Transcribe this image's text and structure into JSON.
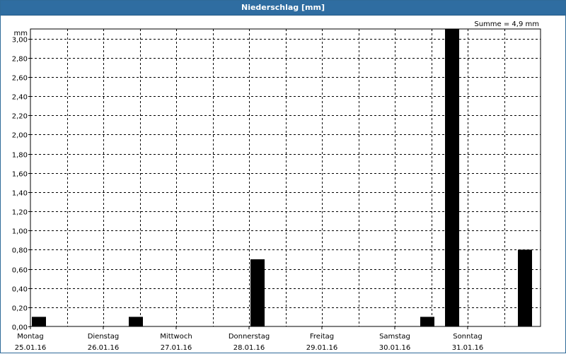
{
  "window": {
    "title": "Niederschlag [mm]"
  },
  "summary": {
    "text": "Summe = 4,9 mm"
  },
  "chart_data": {
    "type": "bar",
    "title": "Niederschlag [mm]",
    "ylabel": "mm",
    "xlabel": "",
    "ylim": [
      0,
      3.1
    ],
    "yticks": [
      "0,00",
      "0,20",
      "0,40",
      "0,60",
      "0,80",
      "1,00",
      "1,20",
      "1,40",
      "1,60",
      "1,80",
      "2,00",
      "2,20",
      "2,40",
      "2,60",
      "2,80",
      "3,00"
    ],
    "x_range_days": [
      0,
      7
    ],
    "days": [
      {
        "weekday": "Montag",
        "date": "25.01.16"
      },
      {
        "weekday": "Dienstag",
        "date": "26.01.16"
      },
      {
        "weekday": "Mittwoch",
        "date": "27.01.16"
      },
      {
        "weekday": "Donnerstag",
        "date": "28.01.16"
      },
      {
        "weekday": "Freitag",
        "date": "29.01.16"
      },
      {
        "weekday": "Samstag",
        "date": "30.01.16"
      },
      {
        "weekday": "Sonntag",
        "date": "31.01.16"
      }
    ],
    "bars": [
      {
        "day": 0.0,
        "value": 0.1
      },
      {
        "day": 1.33,
        "value": 0.1
      },
      {
        "day": 3.0,
        "value": 0.7
      },
      {
        "day": 5.33,
        "value": 0.1
      },
      {
        "day": 5.67,
        "value": 3.1
      },
      {
        "day": 6.67,
        "value": 0.8
      }
    ],
    "bar_color": "#000000",
    "grid": true,
    "total": "4,9 mm"
  }
}
